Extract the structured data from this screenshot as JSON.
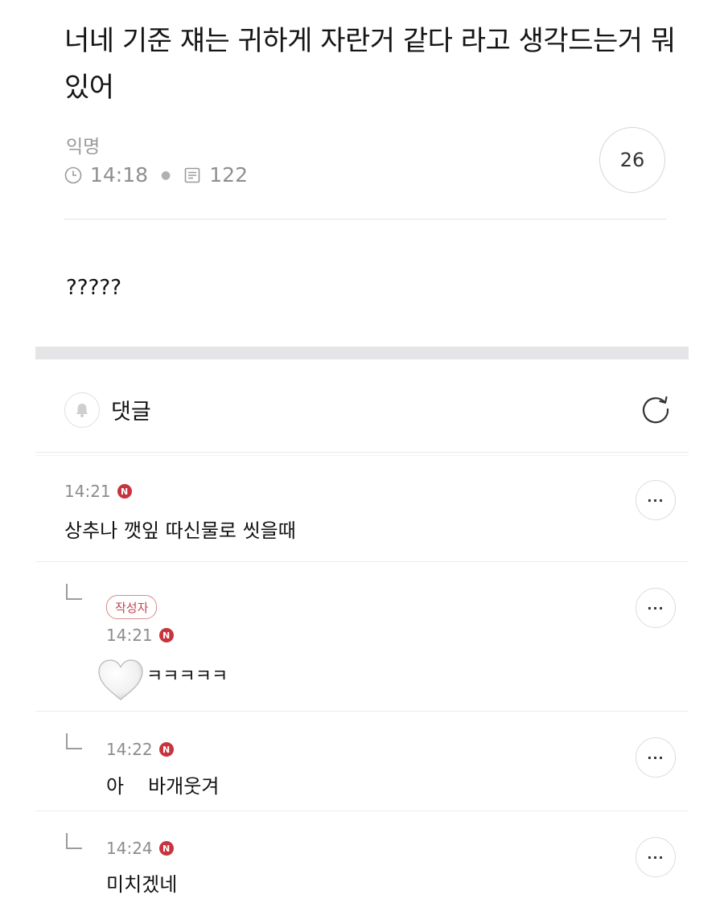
{
  "post": {
    "title": "너네 기준 쟤는 귀하게 자란거 같다 라고 생각드는거 뭐있어",
    "author": "익명",
    "time": "14:18",
    "views": "122",
    "comment_count": "26",
    "body": "?????"
  },
  "comments_section": {
    "label": "댓글"
  },
  "comments": [
    {
      "time": "14:21",
      "badge": "N",
      "text": "상추나 깻잎 따신물로 씻을때"
    },
    {
      "author_tag": "작성자",
      "time": "14:21",
      "badge": "N",
      "text": "ㅋㅋㅋㅋㅋ"
    },
    {
      "time": "14:22",
      "badge": "N",
      "text_part1": "아",
      "text_part2": "바개웃겨"
    },
    {
      "time": "14:24",
      "badge": "N",
      "text": "미치겠네"
    }
  ],
  "more_label": "···",
  "icons": {
    "clock": "clock-icon",
    "views": "document-icon",
    "bell": "bell-icon",
    "refresh": "refresh-icon",
    "heart": "white-heart-emoji"
  },
  "colors": {
    "accent_red": "#c8343e",
    "muted_text": "#8c8c8c",
    "divider": "#e3e3e3"
  }
}
